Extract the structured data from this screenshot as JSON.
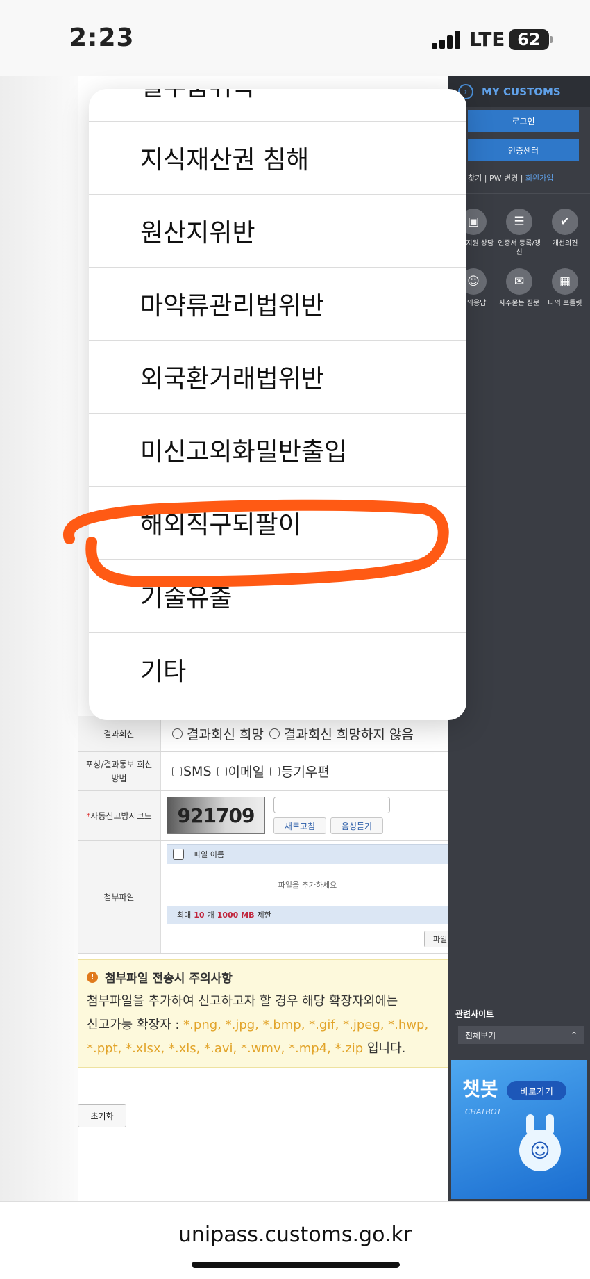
{
  "status_bar": {
    "time": "2:23",
    "network": "LTE",
    "battery": "62"
  },
  "menu_options": [
    "밀수품취득",
    "지식재산권 침해",
    "원산지위반",
    "마약류관리법위반",
    "외국환거래법위반",
    "미신고외화밀반출입",
    "해외직구되팔이",
    "기술유출",
    "기타"
  ],
  "highlighted_option": "해외직구되팔이",
  "annotation_color": "#ff5a14",
  "form": {
    "result_reply": {
      "label": "결과회신",
      "opt_yes": "결과회신 희망",
      "opt_no": "결과회신 희망하지 않음"
    },
    "notify_method": {
      "label": "포상/결과통보 회신방법",
      "opt_sms": "SMS",
      "opt_email": "이메일",
      "opt_mail": "등기우편"
    },
    "captcha": {
      "label": "자동신고방지코드",
      "code": "921709",
      "refresh": "새로고침",
      "audio": "음성듣기"
    },
    "attachment": {
      "label": "첨부파일",
      "column": "파일 이름",
      "empty": "파일을 추가하세요",
      "limit_prefix": "최대",
      "limit_count": "10",
      "limit_mid": "개",
      "limit_size": "1000 MB",
      "limit_suffix": "제한",
      "add_button": "파일"
    },
    "notice": {
      "title": "첨부파일 전송시 주의사항",
      "line1": "첨부파일을 추가하여 신고하고자 할 경우 해당 확장자외에는",
      "line2_prefix": "신고가능 확장자 :",
      "line2_ext": "*.png, *.jpg, *.bmp, *.gif, *.jpeg, *.hwp,",
      "line3_ext": "*.ppt, *.xlsx, *.xls, *.avi, *.wmv, *.mp4, *.zip",
      "line3_suffix": "입니다."
    },
    "reset_button": "초기화"
  },
  "right_panel": {
    "title": "MY CUSTOMS",
    "login": "로그인",
    "cert_center": "인증센터",
    "link_find": "찾기",
    "link_pw": "PW 변경",
    "link_join": "회원가입",
    "icons": [
      {
        "label": "원격지원 상담",
        "icon": "remote-support-icon"
      },
      {
        "label": "인증서 등록/갱신",
        "icon": "certificate-icon"
      },
      {
        "label": "개선의견",
        "icon": "feedback-icon"
      },
      {
        "label": "질의응답",
        "icon": "qna-icon"
      },
      {
        "label": "자주묻는 질문",
        "icon": "faq-icon"
      },
      {
        "label": "나의 포틀릿",
        "icon": "portlet-icon"
      }
    ],
    "related_label": "관련사이트",
    "related_select": "전체보기",
    "chatbot_title": "챗봇",
    "chatbot_go": "바로가기",
    "chatbot_sub": "CHATBOT"
  },
  "url": "unipass.customs.go.kr"
}
